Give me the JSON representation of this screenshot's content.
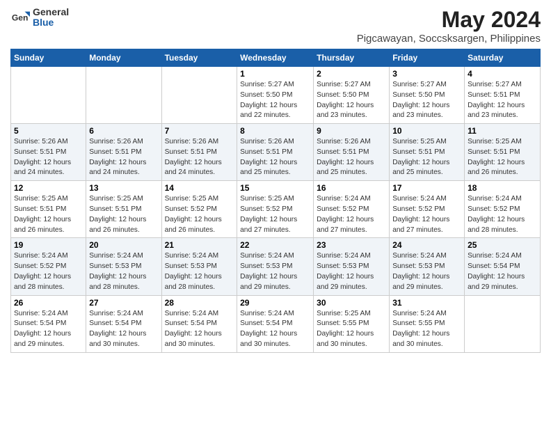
{
  "logo": {
    "general": "General",
    "blue": "Blue"
  },
  "title": "May 2024",
  "subtitle": "Pigcawayan, Soccsksargen, Philippines",
  "days_of_week": [
    "Sunday",
    "Monday",
    "Tuesday",
    "Wednesday",
    "Thursday",
    "Friday",
    "Saturday"
  ],
  "weeks": [
    [
      {
        "num": "",
        "info": ""
      },
      {
        "num": "",
        "info": ""
      },
      {
        "num": "",
        "info": ""
      },
      {
        "num": "1",
        "info": "Sunrise: 5:27 AM\nSunset: 5:50 PM\nDaylight: 12 hours\nand 22 minutes."
      },
      {
        "num": "2",
        "info": "Sunrise: 5:27 AM\nSunset: 5:50 PM\nDaylight: 12 hours\nand 23 minutes."
      },
      {
        "num": "3",
        "info": "Sunrise: 5:27 AM\nSunset: 5:50 PM\nDaylight: 12 hours\nand 23 minutes."
      },
      {
        "num": "4",
        "info": "Sunrise: 5:27 AM\nSunset: 5:51 PM\nDaylight: 12 hours\nand 23 minutes."
      }
    ],
    [
      {
        "num": "5",
        "info": "Sunrise: 5:26 AM\nSunset: 5:51 PM\nDaylight: 12 hours\nand 24 minutes."
      },
      {
        "num": "6",
        "info": "Sunrise: 5:26 AM\nSunset: 5:51 PM\nDaylight: 12 hours\nand 24 minutes."
      },
      {
        "num": "7",
        "info": "Sunrise: 5:26 AM\nSunset: 5:51 PM\nDaylight: 12 hours\nand 24 minutes."
      },
      {
        "num": "8",
        "info": "Sunrise: 5:26 AM\nSunset: 5:51 PM\nDaylight: 12 hours\nand 25 minutes."
      },
      {
        "num": "9",
        "info": "Sunrise: 5:26 AM\nSunset: 5:51 PM\nDaylight: 12 hours\nand 25 minutes."
      },
      {
        "num": "10",
        "info": "Sunrise: 5:25 AM\nSunset: 5:51 PM\nDaylight: 12 hours\nand 25 minutes."
      },
      {
        "num": "11",
        "info": "Sunrise: 5:25 AM\nSunset: 5:51 PM\nDaylight: 12 hours\nand 26 minutes."
      }
    ],
    [
      {
        "num": "12",
        "info": "Sunrise: 5:25 AM\nSunset: 5:51 PM\nDaylight: 12 hours\nand 26 minutes."
      },
      {
        "num": "13",
        "info": "Sunrise: 5:25 AM\nSunset: 5:51 PM\nDaylight: 12 hours\nand 26 minutes."
      },
      {
        "num": "14",
        "info": "Sunrise: 5:25 AM\nSunset: 5:52 PM\nDaylight: 12 hours\nand 26 minutes."
      },
      {
        "num": "15",
        "info": "Sunrise: 5:25 AM\nSunset: 5:52 PM\nDaylight: 12 hours\nand 27 minutes."
      },
      {
        "num": "16",
        "info": "Sunrise: 5:24 AM\nSunset: 5:52 PM\nDaylight: 12 hours\nand 27 minutes."
      },
      {
        "num": "17",
        "info": "Sunrise: 5:24 AM\nSunset: 5:52 PM\nDaylight: 12 hours\nand 27 minutes."
      },
      {
        "num": "18",
        "info": "Sunrise: 5:24 AM\nSunset: 5:52 PM\nDaylight: 12 hours\nand 28 minutes."
      }
    ],
    [
      {
        "num": "19",
        "info": "Sunrise: 5:24 AM\nSunset: 5:52 PM\nDaylight: 12 hours\nand 28 minutes."
      },
      {
        "num": "20",
        "info": "Sunrise: 5:24 AM\nSunset: 5:53 PM\nDaylight: 12 hours\nand 28 minutes."
      },
      {
        "num": "21",
        "info": "Sunrise: 5:24 AM\nSunset: 5:53 PM\nDaylight: 12 hours\nand 28 minutes."
      },
      {
        "num": "22",
        "info": "Sunrise: 5:24 AM\nSunset: 5:53 PM\nDaylight: 12 hours\nand 29 minutes."
      },
      {
        "num": "23",
        "info": "Sunrise: 5:24 AM\nSunset: 5:53 PM\nDaylight: 12 hours\nand 29 minutes."
      },
      {
        "num": "24",
        "info": "Sunrise: 5:24 AM\nSunset: 5:53 PM\nDaylight: 12 hours\nand 29 minutes."
      },
      {
        "num": "25",
        "info": "Sunrise: 5:24 AM\nSunset: 5:54 PM\nDaylight: 12 hours\nand 29 minutes."
      }
    ],
    [
      {
        "num": "26",
        "info": "Sunrise: 5:24 AM\nSunset: 5:54 PM\nDaylight: 12 hours\nand 29 minutes."
      },
      {
        "num": "27",
        "info": "Sunrise: 5:24 AM\nSunset: 5:54 PM\nDaylight: 12 hours\nand 30 minutes."
      },
      {
        "num": "28",
        "info": "Sunrise: 5:24 AM\nSunset: 5:54 PM\nDaylight: 12 hours\nand 30 minutes."
      },
      {
        "num": "29",
        "info": "Sunrise: 5:24 AM\nSunset: 5:54 PM\nDaylight: 12 hours\nand 30 minutes."
      },
      {
        "num": "30",
        "info": "Sunrise: 5:25 AM\nSunset: 5:55 PM\nDaylight: 12 hours\nand 30 minutes."
      },
      {
        "num": "31",
        "info": "Sunrise: 5:24 AM\nSunset: 5:55 PM\nDaylight: 12 hours\nand 30 minutes."
      },
      {
        "num": "",
        "info": ""
      }
    ]
  ]
}
